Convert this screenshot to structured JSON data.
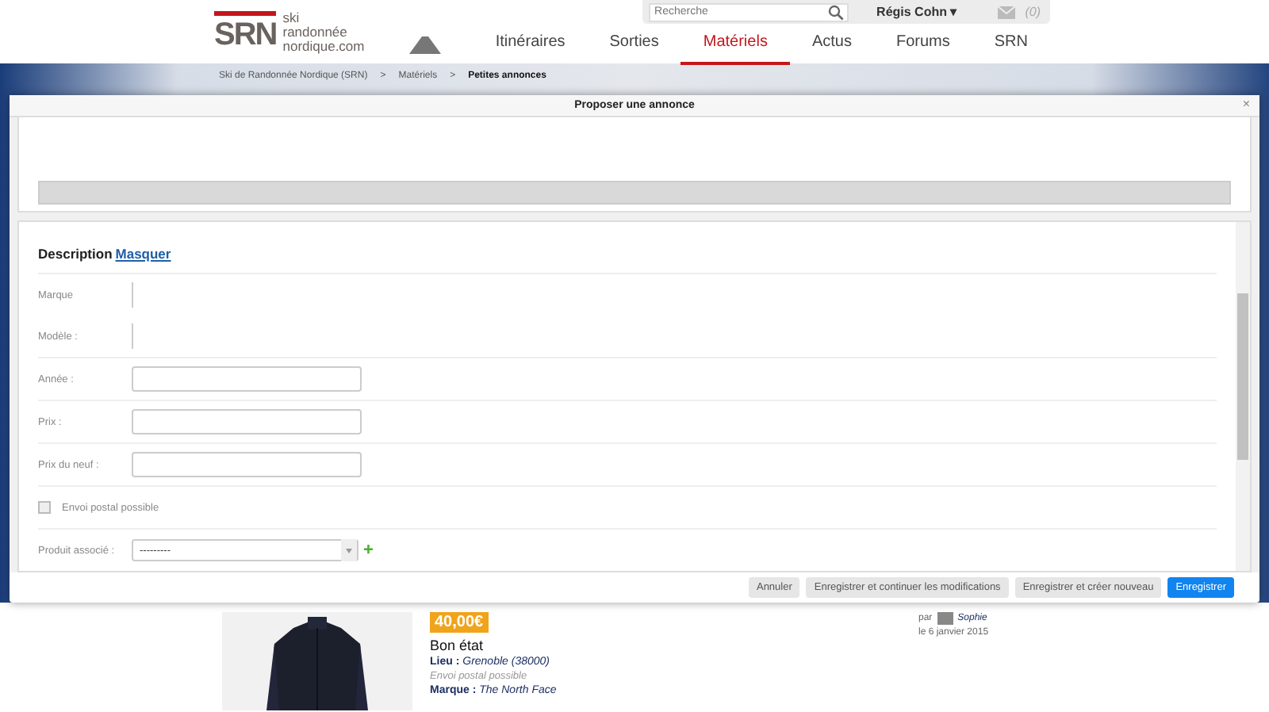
{
  "header": {
    "logo": {
      "initials": "SRN",
      "lines": [
        "ski",
        "randonnée",
        "nordique.com"
      ]
    },
    "search": {
      "placeholder": "Recherche"
    },
    "user": "Régis Cohn ▾",
    "messages": "(0)",
    "nav": [
      {
        "label": "Itinéraires",
        "selected": false
      },
      {
        "label": "Sorties",
        "selected": false
      },
      {
        "label": "Matériels",
        "selected": true
      },
      {
        "label": "Actus",
        "selected": false
      },
      {
        "label": "Forums",
        "selected": false
      },
      {
        "label": "SRN",
        "selected": false
      }
    ]
  },
  "breadcrumb": [
    "Ski de Randonnée Nordique (SRN)",
    "Matériels",
    "Petites annonces"
  ],
  "breadcrumb_separator": ">",
  "modal": {
    "title": "Proposer une annonce",
    "close": "×",
    "section": {
      "title": "Description",
      "toggle_link": "Masquer"
    },
    "fields": [
      {
        "label": "Marque",
        "kind": "plain"
      },
      {
        "label": "Modèle :",
        "kind": "plain"
      },
      {
        "label": "Année :",
        "kind": "text"
      },
      {
        "label": "Prix :",
        "kind": "text"
      },
      {
        "label": "Prix du neuf :",
        "kind": "text"
      },
      {
        "label": "Envoi postal possible",
        "kind": "checkbox",
        "checked": false
      },
      {
        "label": "Produit associé :",
        "kind": "select",
        "value": "---------",
        "add": "+"
      }
    ],
    "buttons": [
      {
        "label": "Annuler",
        "primary": false
      },
      {
        "label": "Enregistrer et continuer les modifications",
        "primary": false
      },
      {
        "label": "Enregistrer et créer nouveau",
        "primary": false
      },
      {
        "label": "Enregistrer",
        "primary": true
      }
    ]
  },
  "listing": {
    "price": "40,00€",
    "condition": "Bon état",
    "place_label": "Lieu :",
    "place": "Grenoble (38000)",
    "shipping": "Envoi postal possible",
    "brand_label": "Marque :",
    "brand": "The North Face",
    "by": "par",
    "author": "Sophie",
    "date": "le 6 janvier 2015"
  }
}
